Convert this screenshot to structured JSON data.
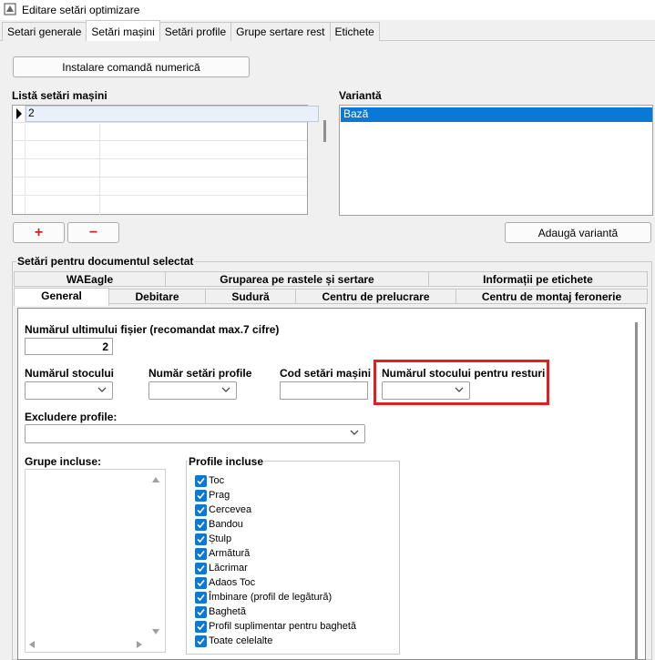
{
  "window": {
    "title": "Editare setări optimizare"
  },
  "tabs": [
    "Setari generale",
    "Setări mașini",
    "Setări profile",
    "Grupe sertare rest",
    "Etichete"
  ],
  "active_tab_index": 1,
  "install_button": "Instalare comandă numerică",
  "machines": {
    "label": "Listă setări mașini",
    "rows": [
      "2"
    ],
    "add_symbol": "+",
    "remove_symbol": "−"
  },
  "variants": {
    "label": "Variantă",
    "items": [
      "Bază"
    ],
    "add_button": "Adaugă variantă"
  },
  "selected_doc": {
    "label": "Setări pentru documentul selectat",
    "tabs_row1": [
      "WAEagle",
      "Gruparea pe rastele și sertare",
      "Informații pe etichete"
    ],
    "tabs_row2": [
      "General",
      "Debitare",
      "Sudură",
      "Centru de prelucrare",
      "Centru de montaj feronerie"
    ],
    "active_tab": "General"
  },
  "general": {
    "last_file_label": "Numărul ultimului fișier (recomandat max.7 cifre)",
    "last_file_value": "2",
    "stock_label": "Numărul stocului",
    "profile_settings_label": "Număr setări profile",
    "machine_code_label": "Cod setări mașini",
    "rest_stock_label": "Numărul stocului pentru resturi",
    "exclude_label": "Excludere profile:",
    "groups_label": "Grupe incluse:",
    "profiles_label": "Profile incluse",
    "profiles": [
      {
        "label": "Toc",
        "checked": true
      },
      {
        "label": "Prag",
        "checked": true
      },
      {
        "label": "Cercevea",
        "checked": true
      },
      {
        "label": "Bandou",
        "checked": true
      },
      {
        "label": "Ștulp",
        "checked": true
      },
      {
        "label": "Armătură",
        "checked": true
      },
      {
        "label": "Lăcrimar",
        "checked": true
      },
      {
        "label": "Adaos Toc",
        "checked": true
      },
      {
        "label": "Îmbinare (profil de legătură)",
        "checked": true
      },
      {
        "label": "Baghetă",
        "checked": true
      },
      {
        "label": "Profil suplimentar pentru baghetă",
        "checked": true
      },
      {
        "label": "Toate celelalte",
        "checked": true
      }
    ]
  },
  "colors": {
    "accent": "#0a78d7",
    "highlight": "#e02020"
  }
}
